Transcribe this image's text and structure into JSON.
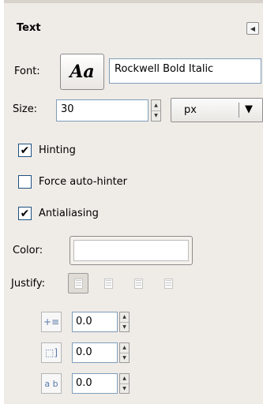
{
  "panel": {
    "title": "Text",
    "menu_icon": "tab-menu-icon"
  },
  "font": {
    "label": "Font:",
    "preview_glyph": "Aa",
    "value": "Rockwell Bold Italic"
  },
  "size": {
    "label": "Size:",
    "value": "30",
    "unit": "px",
    "unit_arrow": "▼"
  },
  "options": [
    {
      "label": "Hinting",
      "checked": true
    },
    {
      "label": "Force auto-hinter",
      "checked": false
    },
    {
      "label": "Antialiasing",
      "checked": true
    }
  ],
  "color": {
    "label": "Color:",
    "value": "#ffffff"
  },
  "justify": {
    "label": "Justify:",
    "buttons": [
      "justify-left-icon",
      "justify-right-icon",
      "justify-center-icon",
      "justify-fill-icon"
    ],
    "active_index": 0
  },
  "properties": {
    "indent": {
      "icon": "indent-icon",
      "glyph": "+≡",
      "value": "0.0"
    },
    "line_spacing": {
      "icon": "line-spacing-icon",
      "glyph": "⬚]",
      "value": "0.0"
    },
    "letter_spacing": {
      "icon": "letter-spacing-icon",
      "glyph": "a b",
      "value": "0.0"
    }
  }
}
